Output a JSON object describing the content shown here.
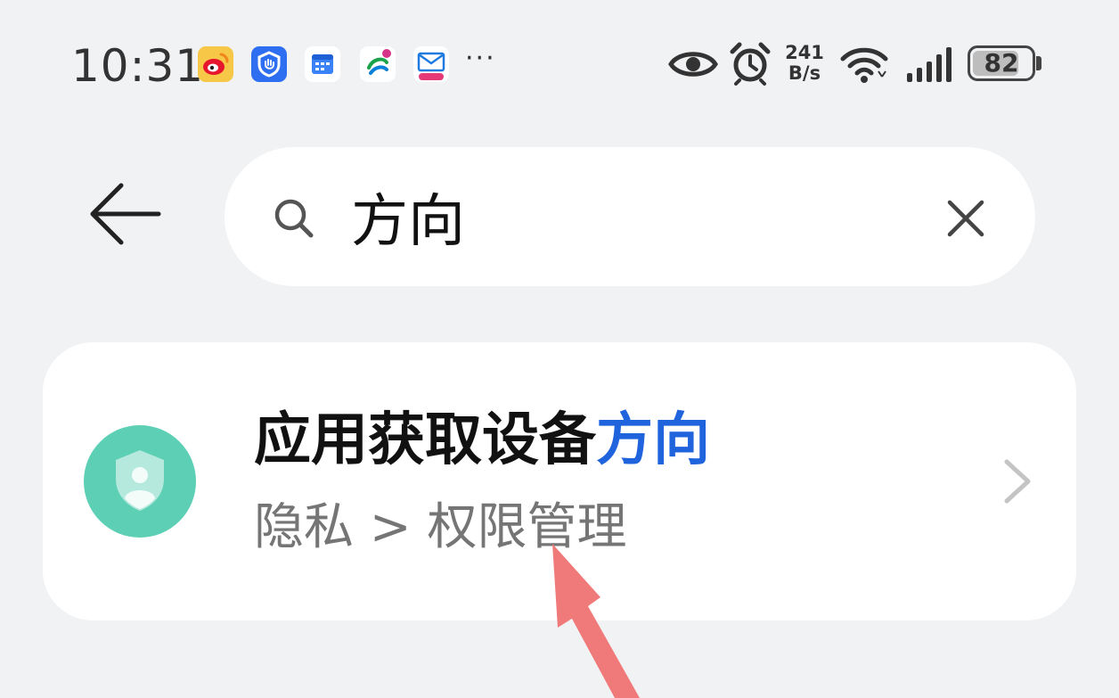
{
  "status_bar": {
    "time": "10:31",
    "notification_icons": [
      "weibo-icon",
      "shield-app-icon",
      "calendar-app-icon",
      "china-mobile-icon",
      "mail-139-icon"
    ],
    "more": "···",
    "net_speed_value": "241",
    "net_speed_unit": "B/s",
    "battery_percent": "82",
    "battery_level": 0.82
  },
  "search": {
    "query": "方向"
  },
  "result": {
    "title_prefix": "应用获取设备",
    "title_highlight": "方向",
    "path": "隐私 > 权限管理",
    "highlight_color": "#1f63dd",
    "icon_color": "#5ccfb4"
  },
  "annotation": {
    "arrow_color": "#f07a7a"
  }
}
